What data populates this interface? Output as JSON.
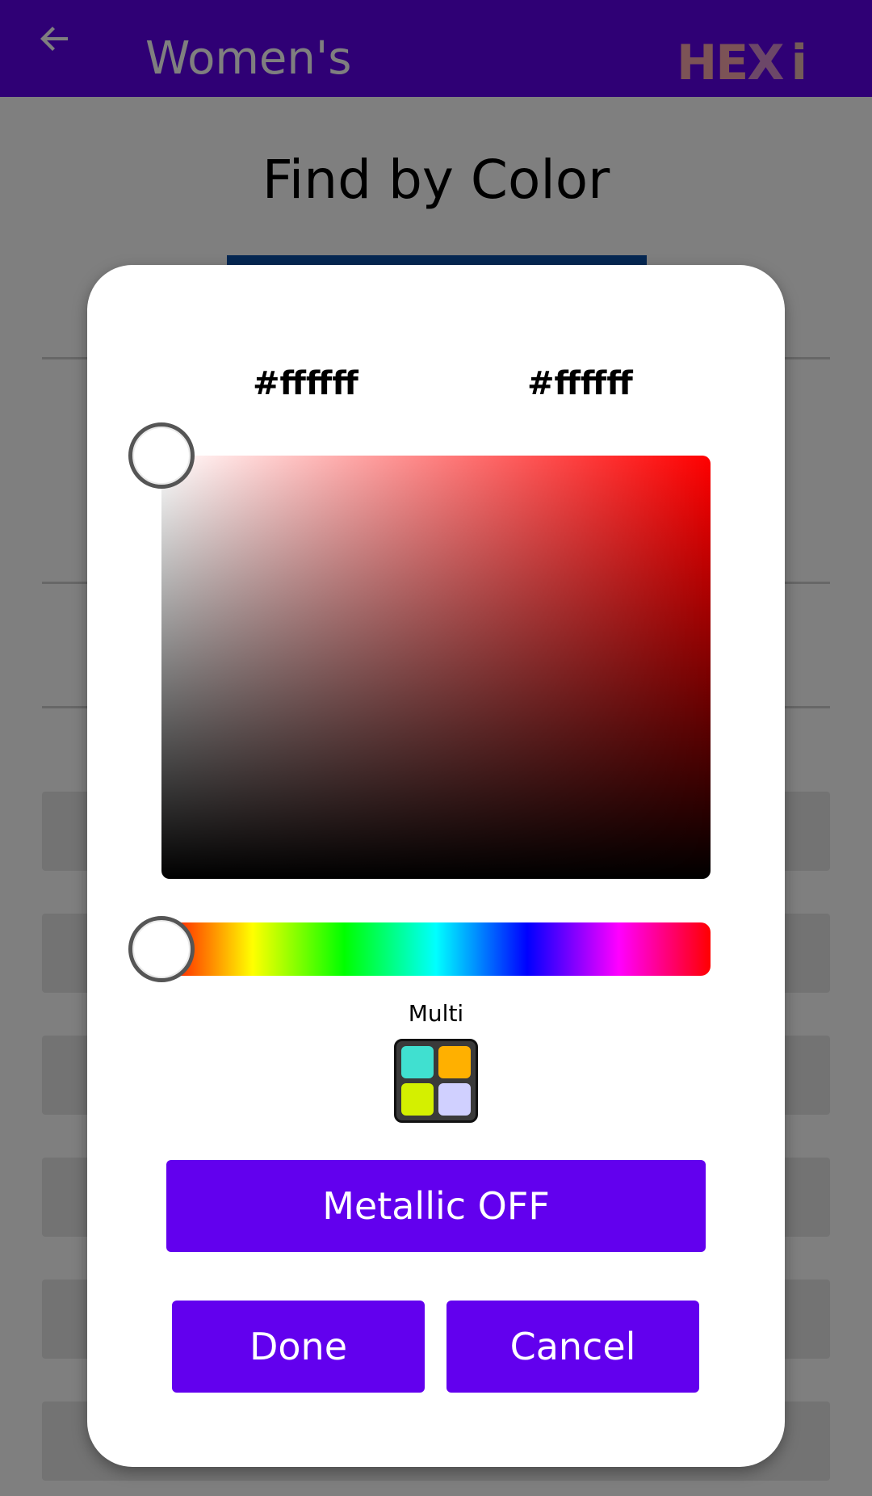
{
  "app_bar": {
    "title": "Women's",
    "logo": [
      "HE",
      "X",
      "i"
    ]
  },
  "page": {
    "heading": "Find by Color"
  },
  "dialog": {
    "hex_left": "#ffffff",
    "hex_right": "#ffffff",
    "multi_label": "Multi",
    "multi_swatches": [
      "#40e0d0",
      "#ffb000",
      "#d4f000",
      "#d0d0ff"
    ],
    "metallic_button": "Metallic OFF",
    "done_button": "Done",
    "cancel_button": "Cancel",
    "selected_hue_fraction": 0.0,
    "saturation": 0.0,
    "value": 1.0
  },
  "colors": {
    "app_bar": "#5f00ea",
    "button": "#6200ee",
    "scrim": "rgba(0,0,0,0.5)"
  }
}
